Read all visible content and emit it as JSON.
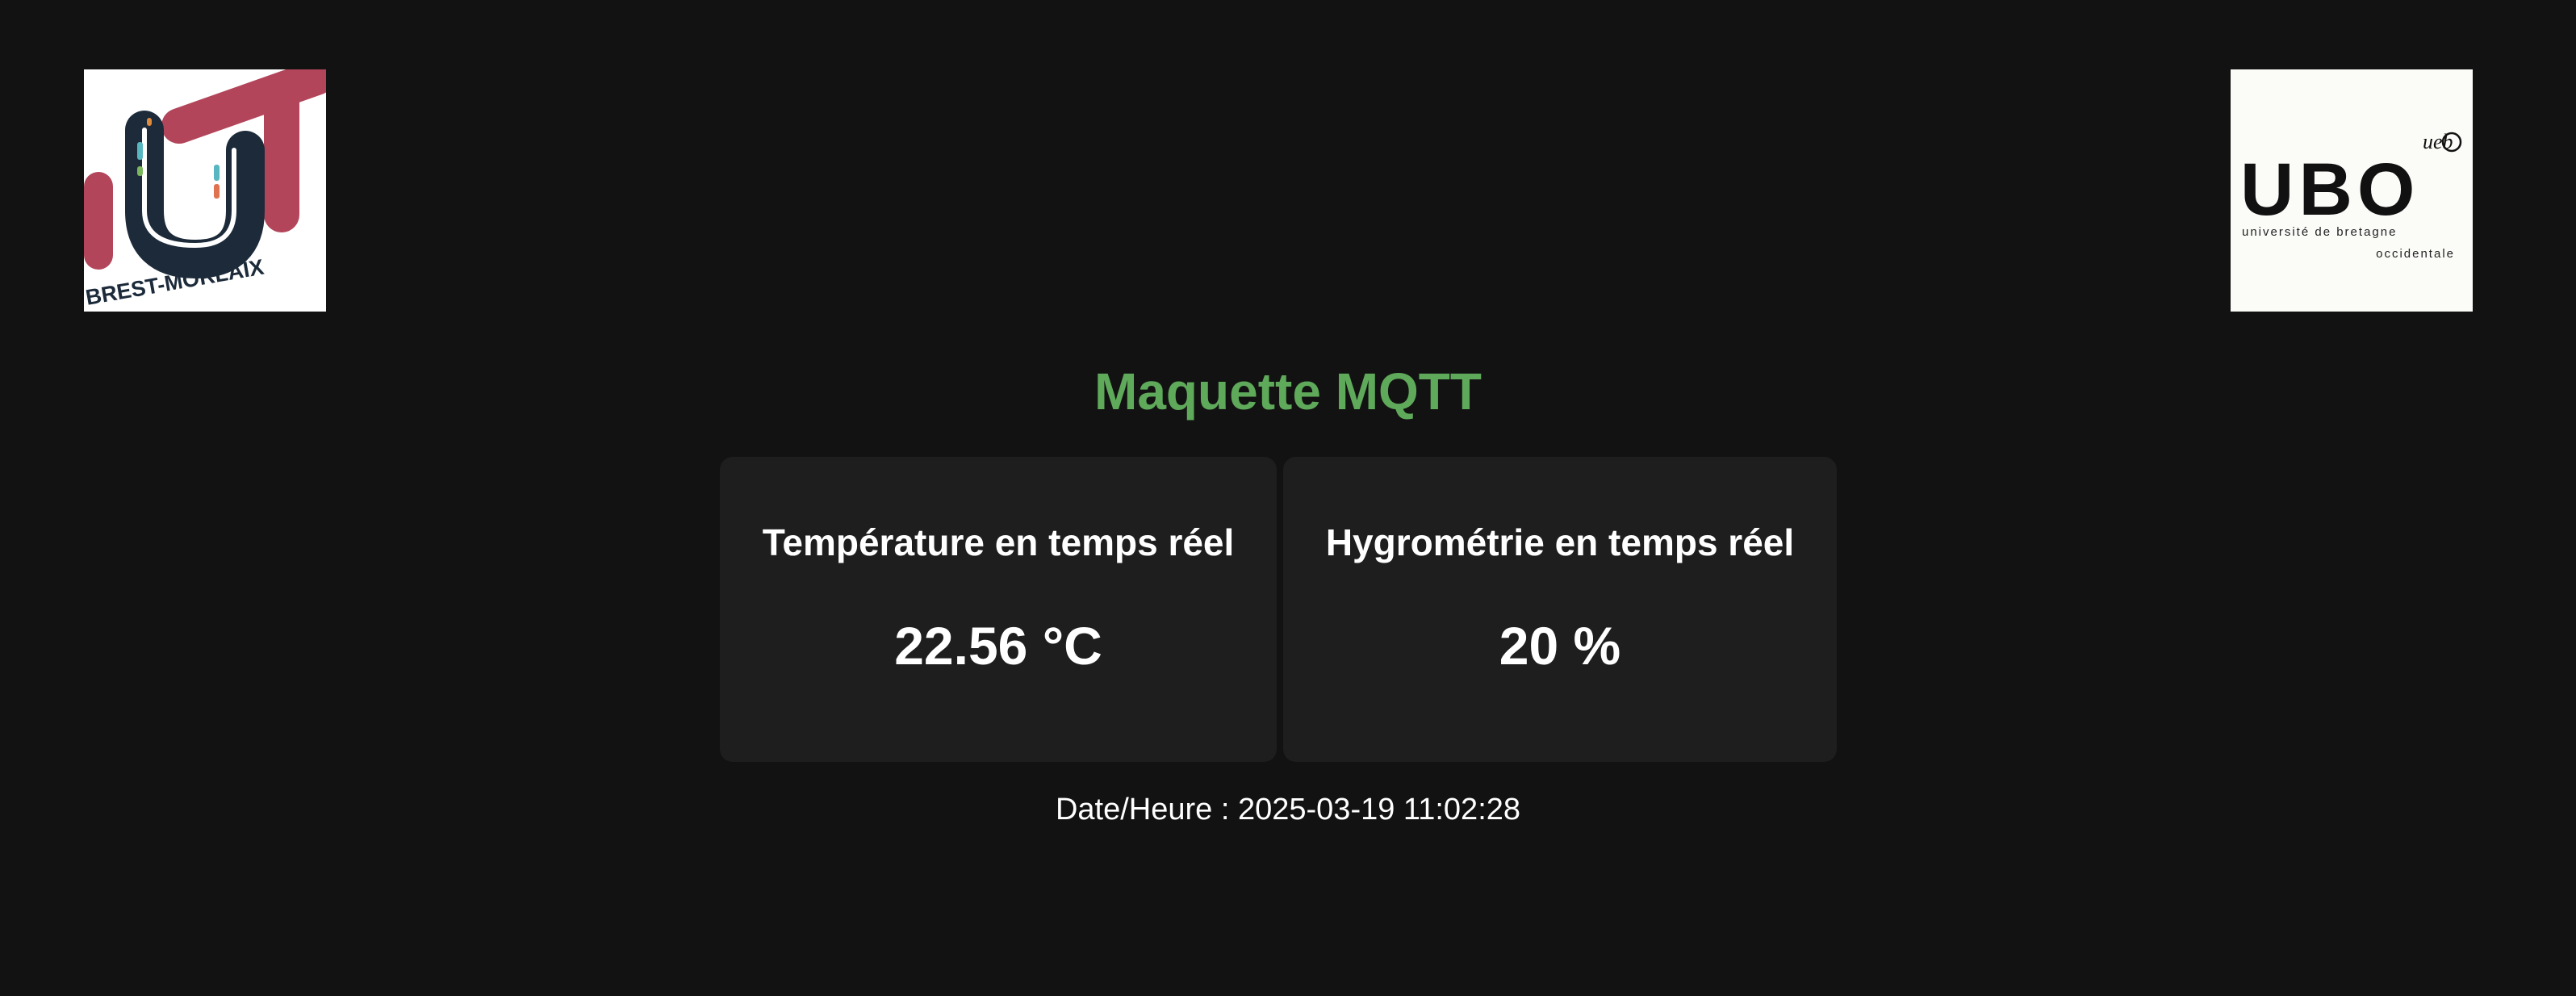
{
  "logos": {
    "left_text": "BREST-MORLAIX",
    "right_wordmark": "UBO",
    "right_badge": "ueb",
    "right_line1": "université de bretagne",
    "right_line2": "occidentale"
  },
  "header": {
    "title": "Maquette MQTT"
  },
  "cards": {
    "temperature": {
      "label": "Température en temps réel",
      "value": "22.56 °C"
    },
    "humidity": {
      "label": "Hygrométrie en temps réel",
      "value": "20 %"
    }
  },
  "footer": {
    "datetime": "Date/Heure : 2025-03-19 11:02:28"
  },
  "colors": {
    "background": "#121212",
    "card": "#1e1e1e",
    "title": "#5fa95a",
    "text": "#ffffff",
    "iut_red": "#b3455a",
    "iut_navy": "#1c2a3a"
  }
}
